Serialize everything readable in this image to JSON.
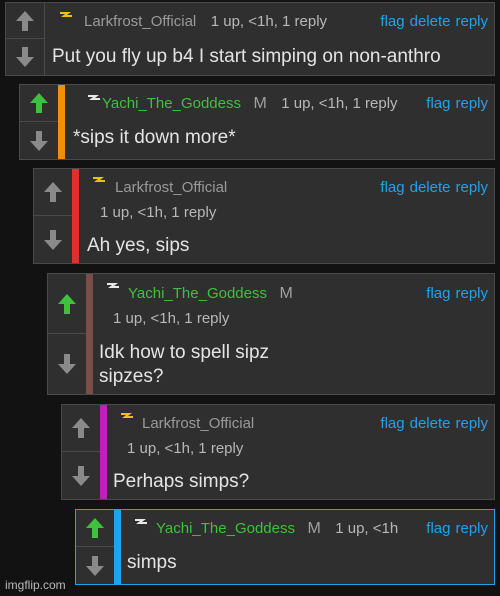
{
  "colors": {
    "panel": "#2f2f2f",
    "border": "#4a4a4a",
    "link": "#1fa3ec",
    "green_user": "#3ec13e",
    "upvote_active": "#3ec13e",
    "arrow_grey": "#8a8a8a"
  },
  "icons": {
    "up": "up-arrow-icon",
    "down": "down-arrow-icon",
    "user": "lightning-icon"
  },
  "comments": [
    {
      "user": "Larkfrost_Official",
      "stats": "1 up, <1h, 1 reply",
      "actions": [
        "flag",
        "delete",
        "reply"
      ],
      "text": "Put you fly up b4 I start simping on non-anthro",
      "upvoted": false,
      "thread_color": ""
    },
    {
      "user": "Yachi_The_Goddess",
      "mod": "M",
      "stats": "1 up, <1h, 1 reply",
      "actions": [
        "flag",
        "reply"
      ],
      "text": "*sips it down more*",
      "upvoted": true,
      "thread_color": "#f0900a"
    },
    {
      "user": "Larkfrost_Official",
      "stats": "1 up, <1h, 1 reply",
      "actions": [
        "flag",
        "delete",
        "reply"
      ],
      "text": "Ah yes, sips",
      "upvoted": false,
      "thread_color": "#e0302e"
    },
    {
      "user": "Yachi_The_Goddess",
      "mod": "M",
      "stats": "1 up, <1h, 1 reply",
      "actions": [
        "flag",
        "reply"
      ],
      "text": "Idk how to spell sipz",
      "text2": "sipzes?",
      "upvoted": true,
      "thread_color": "#7a4d4a"
    },
    {
      "user": "Larkfrost_Official",
      "stats": "1 up, <1h, 1 reply",
      "actions": [
        "flag",
        "delete",
        "reply"
      ],
      "text": "Perhaps simps?",
      "upvoted": false,
      "thread_color": "#c21fb8"
    },
    {
      "user": "Yachi_The_Goddess",
      "mod": "M",
      "stats": "1 up, <1h",
      "actions": [
        "flag",
        "reply"
      ],
      "text": "simps",
      "upvoted": true,
      "thread_color": "#1fa3ec"
    }
  ],
  "watermark": "imgflip.com"
}
